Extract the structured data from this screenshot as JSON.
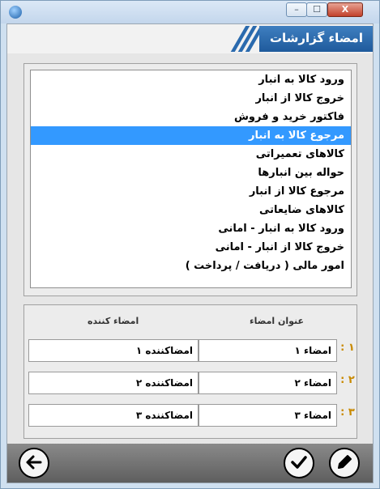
{
  "window": {
    "controls": {
      "minimize": "–",
      "maximize": "☐",
      "close": "X"
    }
  },
  "header": {
    "title": "امضاء گزارشات"
  },
  "report_list": {
    "items": [
      "ورود کالا به انبار",
      "خروج کالا از انبار",
      "فاکتور خرید و فروش",
      "مرجوع کالا به انبار",
      "کالاهای تعمیراتی",
      "حواله بین انبارها",
      "مرجوع کالا از انبار",
      "کالاهای ضایعاتی",
      "ورود کالا به انبار - امانی",
      "خروج کالا از انبار - امانی",
      "امور مالی ( دریافت / پرداخت )"
    ],
    "selected_index": 3
  },
  "signatures": {
    "headers": {
      "title": "عنوان امضاء",
      "signer": "امضاء کننده"
    },
    "rows": [
      {
        "num": "۱ :",
        "title": "امضاء ۱",
        "signer": "امضاکننده ۱"
      },
      {
        "num": "۲ :",
        "title": "امضاء ۲",
        "signer": "امضاکننده ۲"
      },
      {
        "num": "۳ :",
        "title": "امضاء ۳",
        "signer": "امضاکننده ۳"
      }
    ]
  },
  "footer": {
    "back_icon": "arrow-left-icon",
    "confirm_icon": "check-icon",
    "edit_icon": "pencil-icon"
  },
  "colors": {
    "accent": "#2a6aae",
    "selection": "#3399ff",
    "row_number": "#c98a00"
  }
}
